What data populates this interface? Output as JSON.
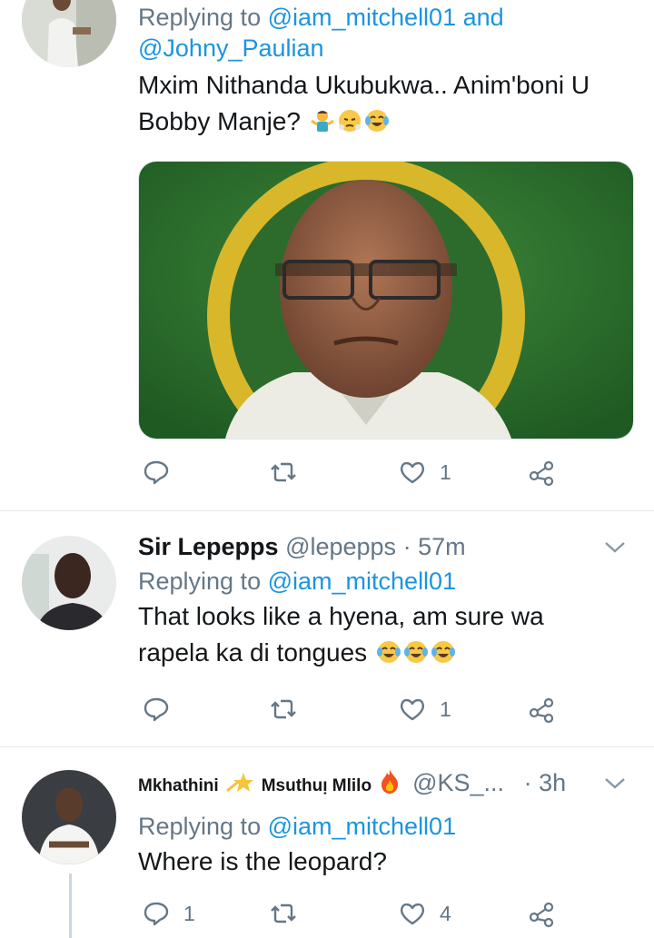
{
  "tweets": [
    {
      "replying_prefix": "Replying to",
      "mention1": "@iam_mitchell01",
      "and": "and",
      "mention2": "@Johny_Paulian",
      "text_line1": "Mxim Nithanda Ukubukwa.. Anim'boni U",
      "text_line2": "Bobby Manje?",
      "emoji": [
        "person-shrugging-emoji",
        "face-with-steam-emoji",
        "tears-of-joy-emoji"
      ],
      "actions": {
        "reply_count": "",
        "retweet_count": "",
        "like_count": "1"
      }
    },
    {
      "name": "Sir Lepepps",
      "handle": "@lepepps",
      "sep": "·",
      "time": "57m",
      "replying_prefix": "Replying to",
      "mention1": "@iam_mitchell01",
      "text_line1": "That looks like a hyena, am sure wa",
      "text_line2": "rapela ka di tongues",
      "emoji": [
        "tears-of-joy-emoji",
        "tears-of-joy-emoji",
        "tears-of-joy-emoji"
      ],
      "actions": {
        "reply_count": "",
        "retweet_count": "",
        "like_count": "1"
      }
    },
    {
      "name_part1": "Mkhathini",
      "name_part2": "Msuthuı̣ Mlilo",
      "handle": "@KS_...",
      "sep": "·",
      "time": "3h",
      "replying_prefix": "Replying to",
      "mention1": "@iam_mitchell01",
      "text_line1": "Where is the leopard?",
      "actions": {
        "reply_count": "1",
        "retweet_count": "",
        "like_count": "4"
      }
    }
  ],
  "colors": {
    "link": "#1b95e0",
    "muted": "#657786",
    "text": "#14171a",
    "divider": "#e1e8ed"
  }
}
